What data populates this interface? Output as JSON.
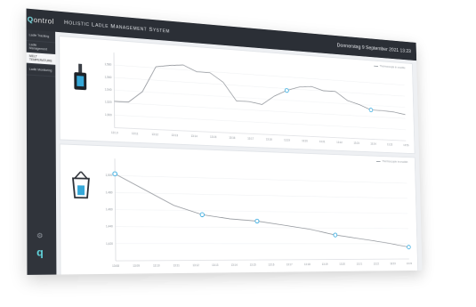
{
  "header": {
    "logo_text": "ontrol",
    "logo_accent": "Q",
    "title": "Holistic Ladle Management System",
    "datetime": "Donnerstag 9 September 2021 13:23"
  },
  "sidebar": {
    "items": [
      {
        "label": "Ladle Tracking",
        "active": false
      },
      {
        "label": "Ladle Management",
        "active": false
      },
      {
        "label": "MELT TEMPERATURE",
        "active": true
      },
      {
        "label": "Ladle Monitoring",
        "active": false
      }
    ],
    "settings_icon": "gear-icon",
    "bottom_logo": "q"
  },
  "panels": [
    {
      "legend": "Thermocouple in crucible",
      "icon": "ladle-filled-icon",
      "chart_data": {
        "type": "line",
        "y_ticks": [
          "1,580",
          "1,560",
          "1,540",
          "1,520",
          "1,500"
        ],
        "x_ticks": [
          "13:10",
          "13:11",
          "13:12",
          "13:13",
          "13:14",
          "13:15",
          "13:16",
          "13:17",
          "13:18",
          "13:19",
          "13:20",
          "13:21",
          "13:22",
          "13:23",
          "13:24",
          "13:25",
          "13:26"
        ],
        "values": [
          1525,
          1525,
          1540,
          1575,
          1578,
          1580,
          1572,
          1572,
          1560,
          1535,
          1535,
          1532,
          1545,
          1554,
          1560,
          1562,
          1557,
          1557,
          1545,
          1540,
          1533,
          1533,
          1532,
          1529
        ],
        "markers": [
          13,
          20
        ],
        "ylim": [
          1490,
          1590
        ]
      }
    },
    {
      "legend": "Thermocouple in crucible",
      "icon": "crucible-icon",
      "chart_data": {
        "type": "line",
        "y_ticks": [
          "1,500",
          "1,480",
          "1,460",
          "1,440",
          "1,420"
        ],
        "x_ticks": [
          "13:08",
          "13:09",
          "13:10",
          "13:11",
          "13:12",
          "13:13",
          "13:14",
          "13:15",
          "13:16",
          "13:17",
          "13:18",
          "13:19",
          "13:20",
          "13:21",
          "13:22",
          "13:23",
          "13:24"
        ],
        "values": [
          1495,
          1480,
          1465,
          1456,
          1452,
          1450,
          1446,
          1442,
          1436,
          1432,
          1428,
          1423
        ],
        "markers": [
          0,
          3,
          5,
          8,
          11
        ],
        "ylim": [
          1410,
          1510
        ]
      }
    }
  ]
}
